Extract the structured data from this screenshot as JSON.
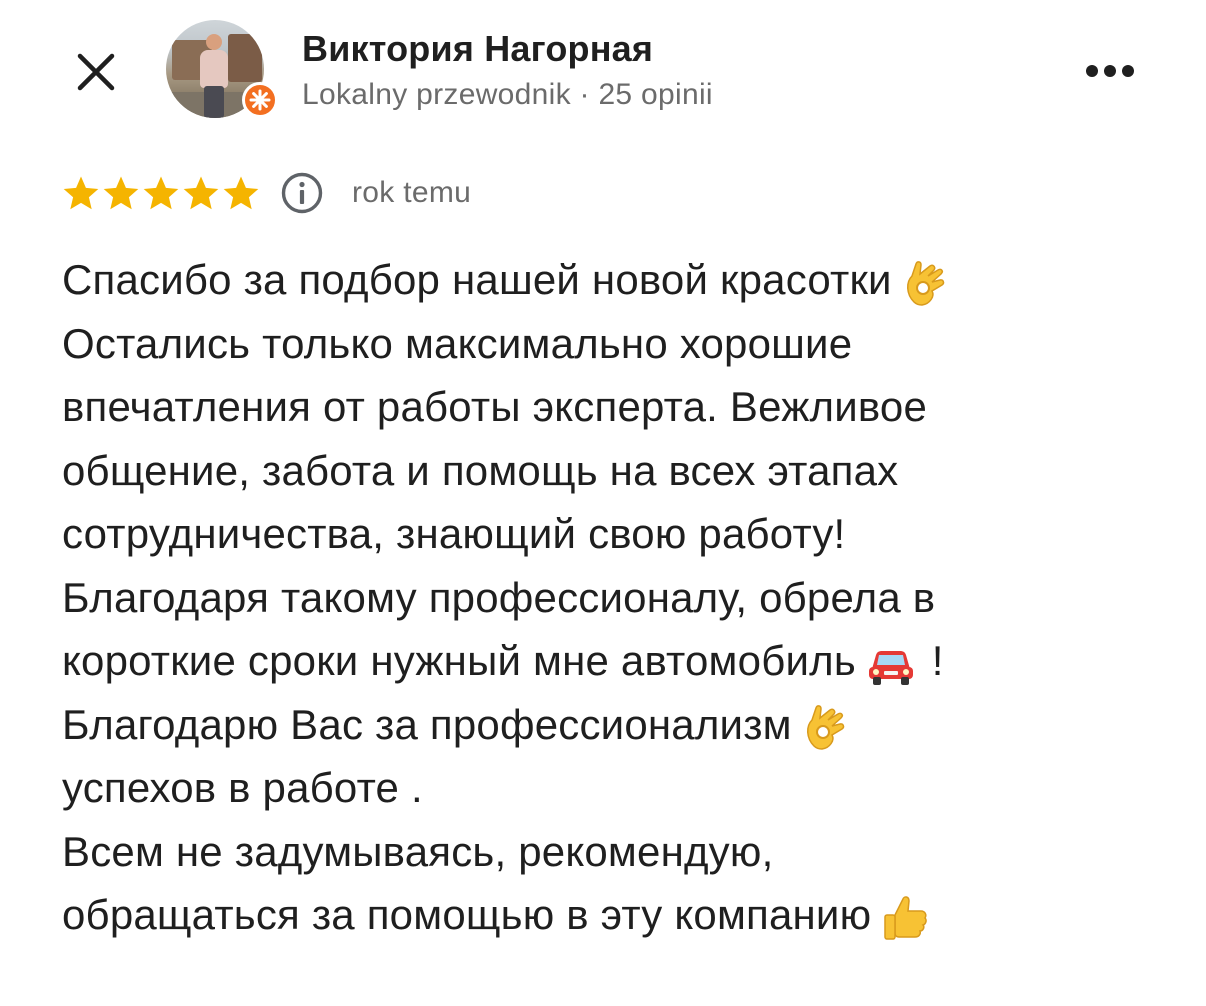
{
  "header": {
    "close_icon": "close-icon",
    "user_name": "Виктория Нагорная",
    "user_meta": "Lokalny przewodnik · 25 opinii",
    "badge_icon": "local-guide-star-icon",
    "more_icon": "more-horizontal-icon"
  },
  "rating": {
    "stars": 5,
    "max_stars": 5,
    "star_color": "#f5b400",
    "info_icon": "info-icon",
    "time_ago": "rok temu"
  },
  "review": {
    "lines": [
      {
        "text": "Спасибо за подбор нашей новой красотки",
        "emoji": "ok-hand-emoji"
      },
      {
        "text": "Остались только максимально хорошие"
      },
      {
        "text": "впечатления от работы эксперта. Вежливое"
      },
      {
        "text": "общение, забота и помощь на всех этапах"
      },
      {
        "text": "сотрудничества, знающий свою работу!"
      },
      {
        "text": "Благодаря такому профессионалу, обрела в"
      },
      {
        "text": "короткие сроки нужный мне автомобиль",
        "emoji": "red-car-emoji",
        "suffix": " !"
      },
      {
        "text": "Благодарю Вас за профессионализм",
        "emoji": "ok-hand-emoji"
      },
      {
        "text": "успехов в работе ."
      },
      {
        "text": "Всем не задумываясь, рекомендую,"
      },
      {
        "text": "обращаться за помощью в эту компанию",
        "emoji": "thumbs-up-emoji"
      }
    ]
  }
}
